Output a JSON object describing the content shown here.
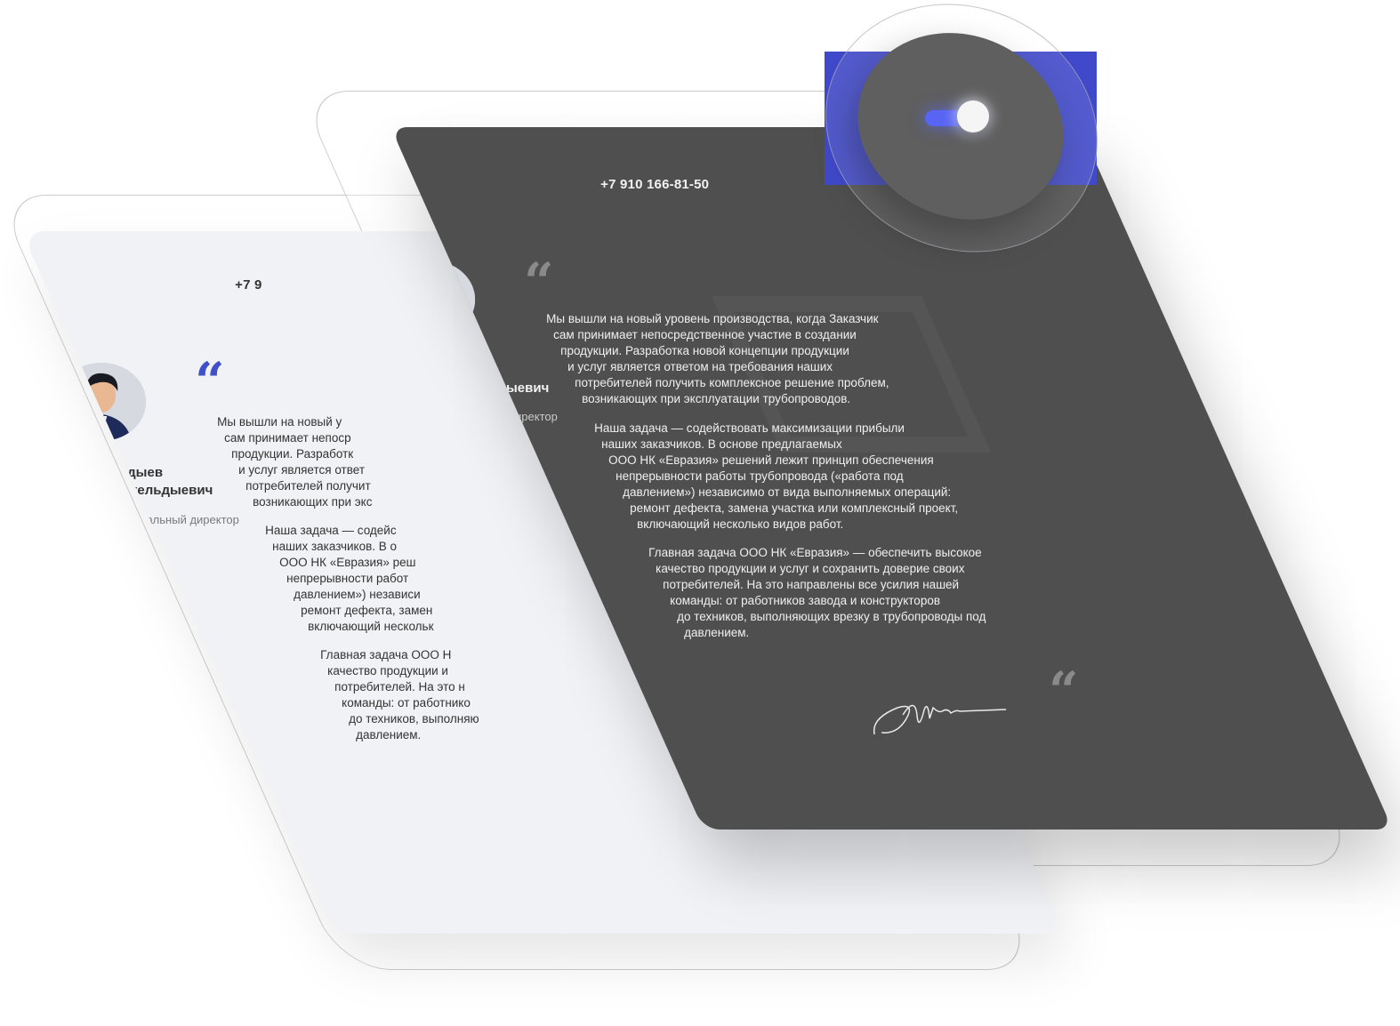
{
  "brand": {
    "logo_letter": "N"
  },
  "contact": {
    "phone": "+7 910 166-81-50",
    "phone_partial": "+7 9"
  },
  "person": {
    "surname": "Бердыев",
    "given": "Денис Амангельдыевич",
    "role": "Генеральный директор"
  },
  "quote_mark": "“",
  "letter": {
    "p1": [
      "Мы вышли на новый уровень производства, когда Заказчик",
      "сам принимает непосредственное участие в создании",
      "продукции. Разработка новой концепции продукции",
      "и услуг является ответом на требования наших",
      "потребителей получить комплексное решение проблем,",
      "возникающих при эксплуатации трубопроводов."
    ],
    "p2": [
      "Наша задача — содействовать максимизации прибыли",
      "наших заказчиков. В основе предлагаемых",
      "ООО НК «Евразия» решений лежит принцип обеспечения",
      "непрерывности работы трубопровода («работа под",
      "давлением») независимо от вида выполняемых операций:",
      "ремонт дефекта, замена участка или комплексный проект,",
      "включающий несколько видов работ."
    ],
    "p3": [
      "Главная задача ООО НК «Евразия» — обеспечить высокое",
      "качество продукции и услуг и сохранить доверие своих",
      "потребителей. На это направлены все усилия нашей",
      "команды: от работников завода и конструкторов",
      "до техников, выполняющих врезку в трубопроводы под",
      "давлением."
    ]
  },
  "light_letter": {
    "p1": [
      "Мы вышли на новый у",
      "сам принимает непоср",
      "продукции. Разработк",
      "и услуг является ответ",
      "потребителей получит",
      "возникающих при экс"
    ],
    "p2": [
      "Наша задача — содейс",
      "наших заказчиков. В о",
      "ООО НК «Евразия» реш",
      "непрерывности работ",
      "давлением») независи",
      "ремонт дефекта, замен",
      "включающий нескольк"
    ],
    "p3": [
      "Главная задача ООО Н",
      "качество продукции и",
      "потребителей. На это н",
      "команды: от работнико",
      "до техников, выполняю",
      "давлением."
    ]
  },
  "colors": {
    "accent": "#4049c9",
    "dark_card": "#4f4f4f",
    "light_card": "#f1f2f6",
    "toggle_on": "#5865f2"
  },
  "toggle": {
    "state": "on"
  }
}
